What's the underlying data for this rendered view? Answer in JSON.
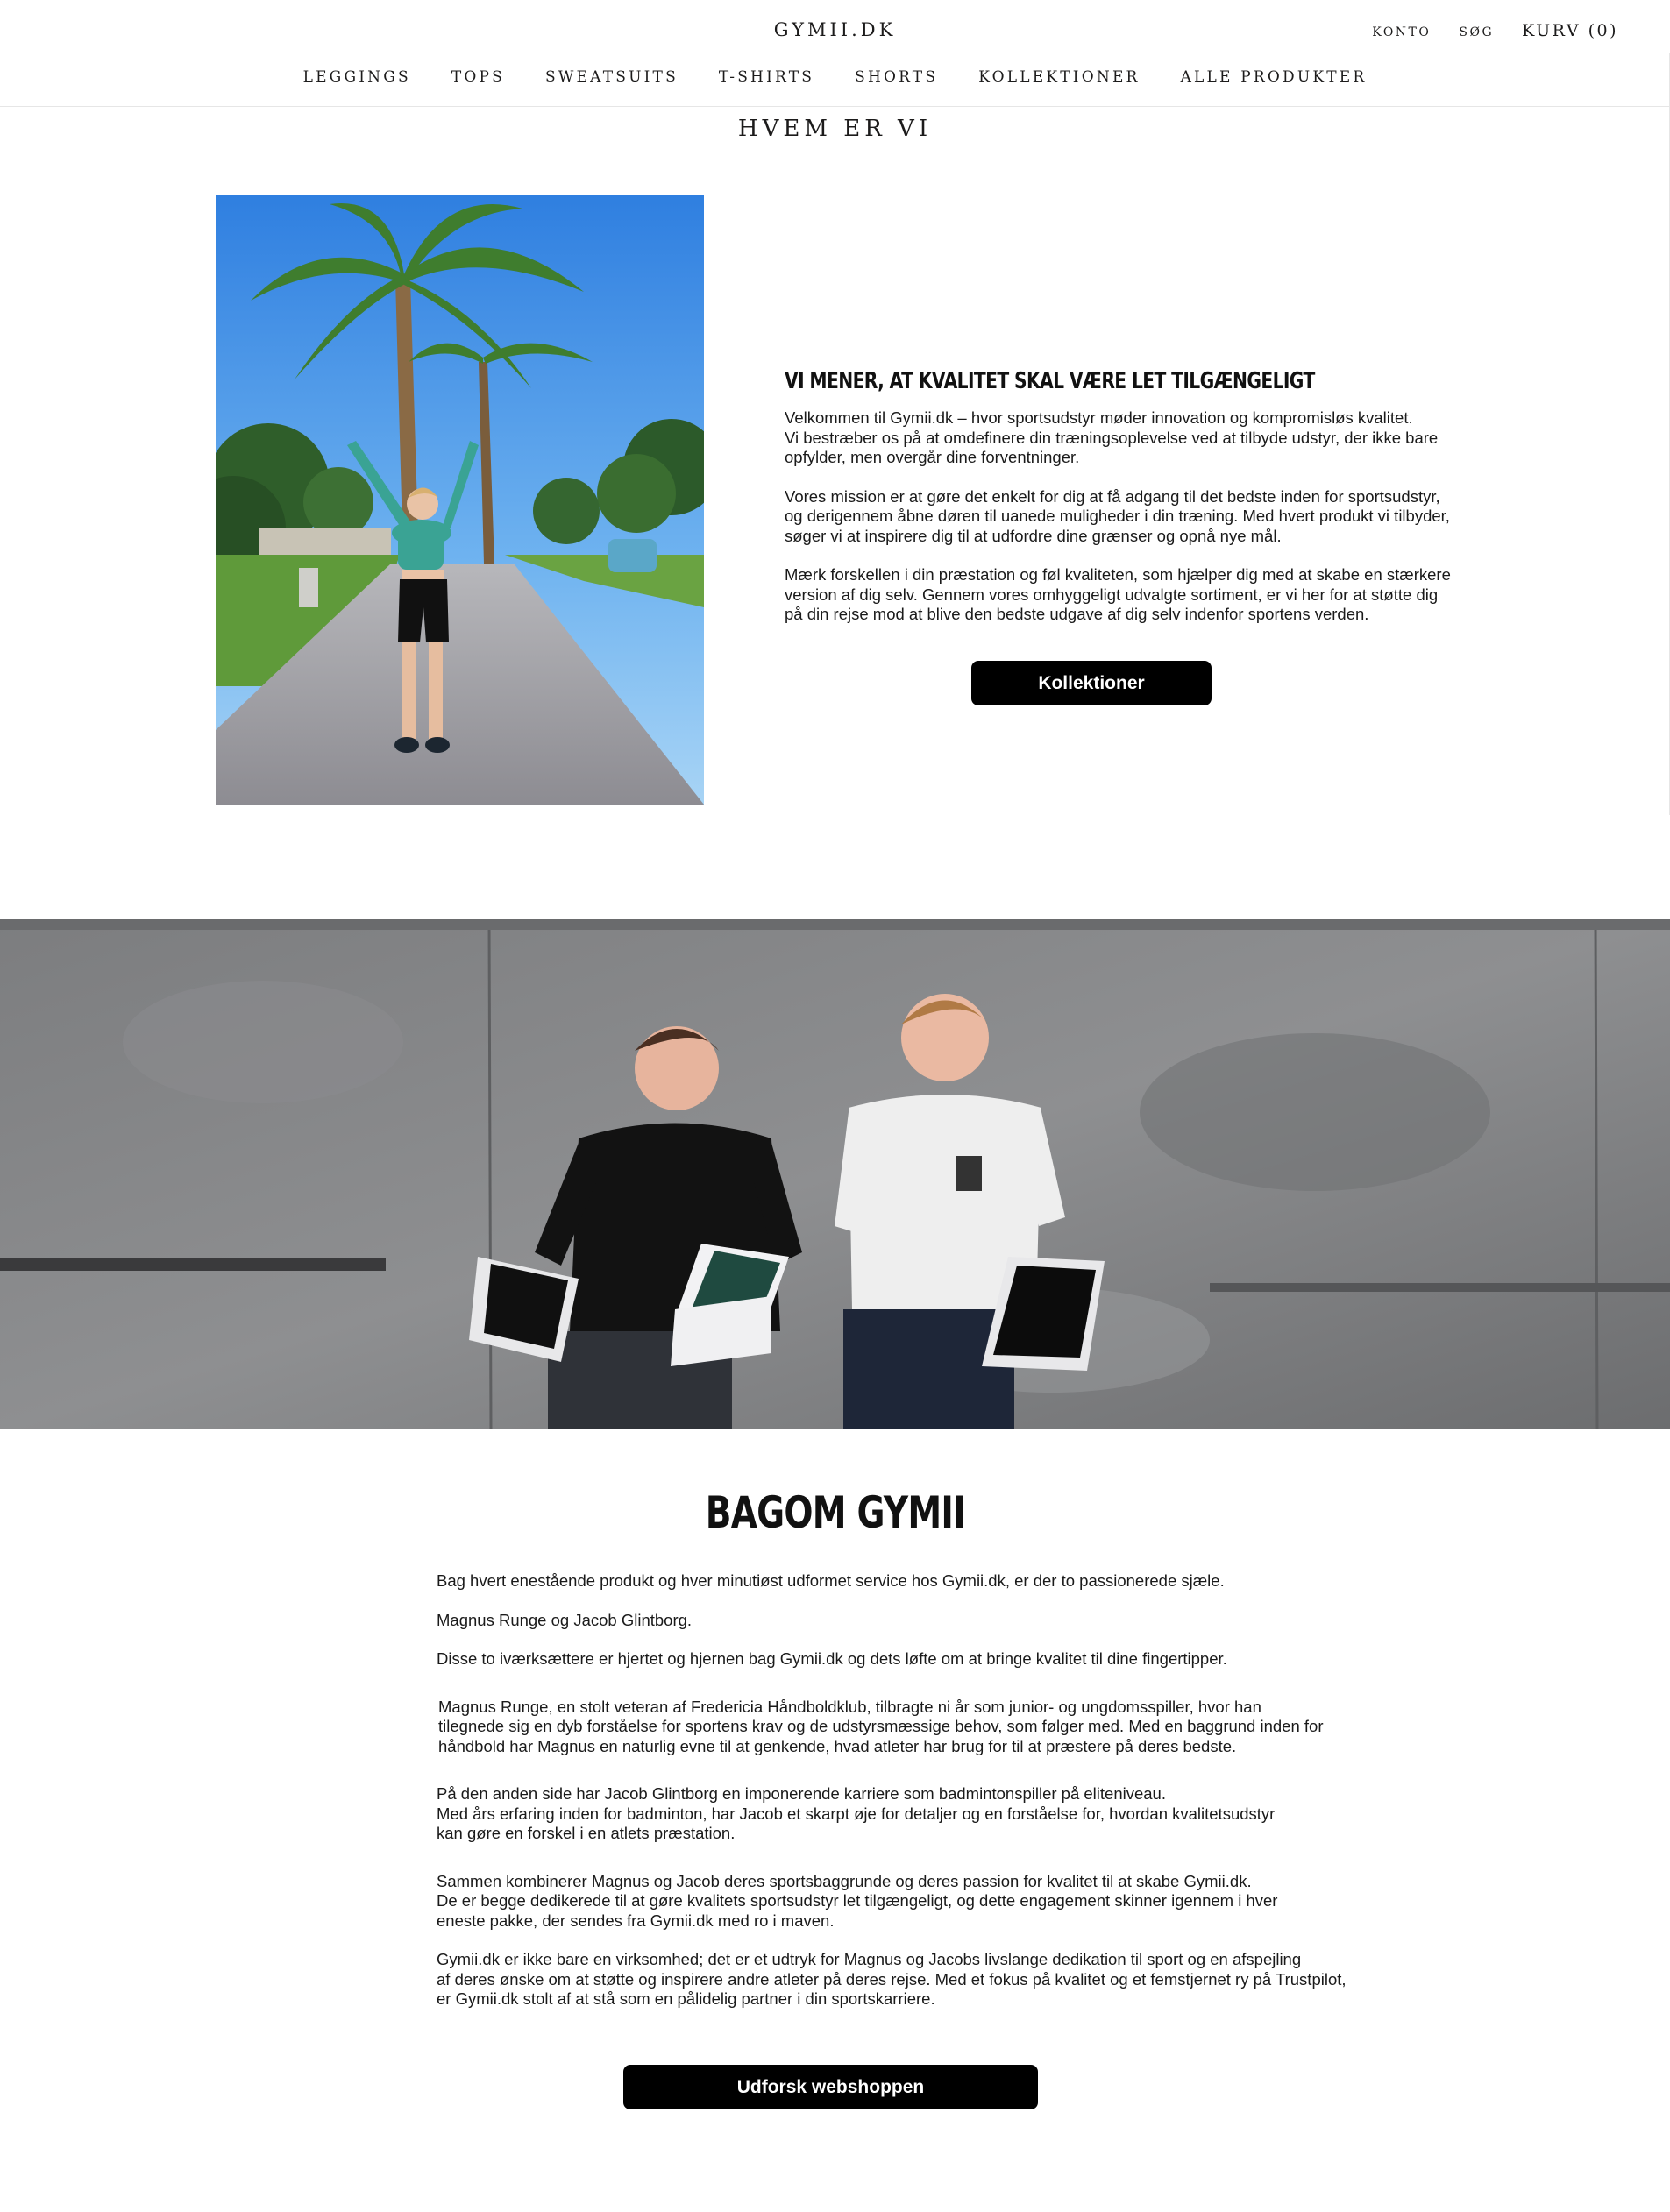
{
  "header": {
    "logo": "GYMII.DK",
    "account": "KONTO",
    "search": "SØG",
    "cart": "KURV (0)"
  },
  "nav": [
    "LEGGINGS",
    "TOPS",
    "SWEATSUITS",
    "T-SHIRTS",
    "SHORTS",
    "KOLLEKTIONER",
    "ALLE PRODUKTER"
  ],
  "about": {
    "title": "HVEM ER VI",
    "headline": "VI MENER, AT KVALITET SKAL VÆRE LET TILGÆNGELIGT",
    "paragraphs": [
      "Velkommen til Gymii.dk – hvor sportsudstyr møder innovation og kompromisløs kvalitet.\nVi bestræber os på at omdefinere din træningsoplevelse ved at tilbyde udstyr, der ikke bare\nopfylder, men overgår dine forventninger.",
      "Vores mission er at gøre det enkelt for dig at få adgang til det bedste inden for sportsudstyr,\nog derigennem åbne døren til uanede muligheder i din træning. Med hvert produkt vi tilbyder,\nsøger vi at inspirere dig til at udfordre dine grænser og opnå nye mål.",
      "Mærk forskellen i din præstation og føl kvaliteten, som hjælper dig med at skabe en stærkere\nversion af dig selv. Gennem vores omhyggeligt udvalgte sortiment, er vi her for at støtte dig\npå din rejse mod at blive den bedste udgave af dig selv indenfor sportens verden."
    ],
    "button": "Kollektioner"
  },
  "behind": {
    "title": "BAGOM GYMII",
    "paragraphs": [
      "Bag hvert enestående produkt og hver minutiøst udformet service hos Gymii.dk, er der to passionerede sjæle.",
      "Magnus Runge og Jacob Glintborg.",
      "Disse to iværksættere er hjertet og hjernen bag Gymii.dk og dets løfte om at bringe kvalitet til dine fingertipper.",
      "Magnus Runge, en stolt veteran af Fredericia Håndboldklub, tilbragte ni år som junior- og ungdomsspiller, hvor han\ntilegnede sig en dyb forståelse for sportens krav og de udstyrsmæssige behov, som følger med. Med en baggrund inden for\nhåndbold har Magnus en naturlig evne til at genkende, hvad atleter har brug for til at præstere på deres bedste.",
      "På den anden side har Jacob Glintborg en imponerende karriere som badmintonspiller på eliteniveau.\nMed års erfaring inden for badminton, har Jacob et skarpt øje for detaljer og en forståelse for, hvordan kvalitetsudstyr\nkan gøre en forskel i en atlets præstation.",
      "Sammen kombinerer Magnus og Jacob deres sportsbaggrunde og deres passion for kvalitet til at skabe Gymii.dk.\nDe er begge dedikerede til at gøre kvalitets sportsudstyr let tilgængeligt, og dette engagement skinner igennem i hver\neneste pakke, der sendes fra Gymii.dk med ro i maven.",
      "Gymii.dk er ikke bare en virksomhed; det er et udtryk for Magnus og Jacobs livslange dedikation til sport og en afspejling\naf deres ønske om at støtte og inspirere andre atleter på deres rejse. Med et fokus på kvalitet og et femstjernet ry på Trustpilot,\ner Gymii.dk stolt af at stå som en pålidelig partner i din sportskarriere."
    ],
    "button": "Udforsk webshoppen"
  },
  "colors": {
    "button_bg": "#000000",
    "button_text": "#ffffff",
    "text": "#1c1b1b",
    "border": "#e6e6e6"
  }
}
